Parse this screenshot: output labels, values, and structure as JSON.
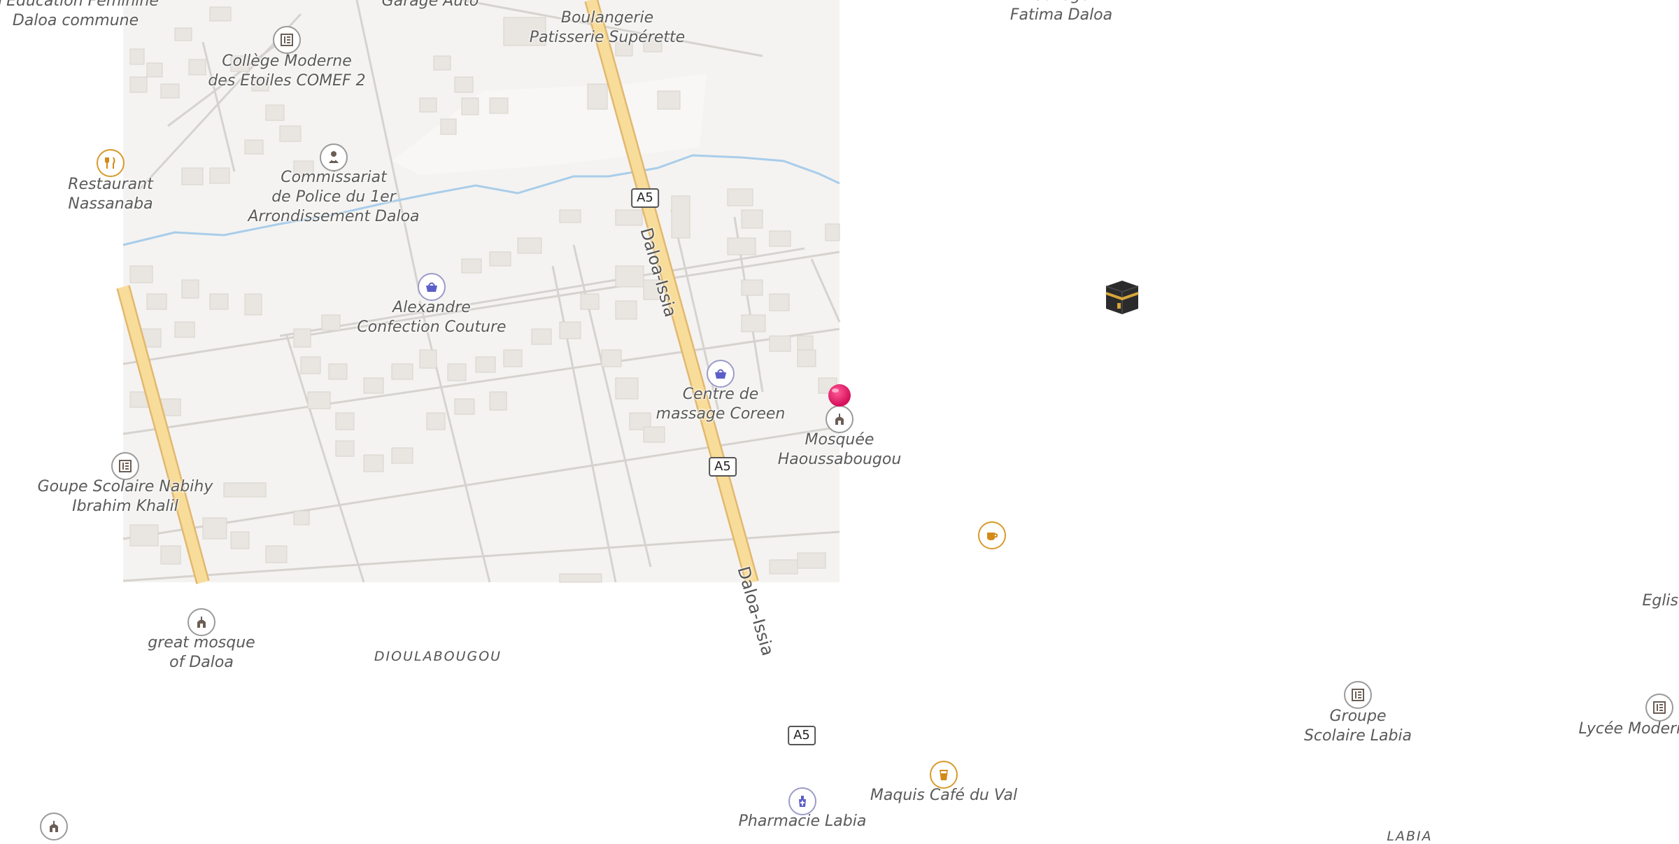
{
  "map": {
    "places": {
      "edu_feminine": "d'Education Féminine\nDaloa commune",
      "garage": "Garage Auto",
      "boulangerie": "Boulangerie\nPatisserie Supérette",
      "college_fatima": "College\nFatima Daloa",
      "college_comef": "Collège Moderne\ndes Etoiles COMEF 2",
      "restaurant": "Restaurant\nNassanaba",
      "commissariat": "Commissariat\nde Police du 1er\nArrondissement Daloa",
      "alexandre": "Alexandre\nConfection Couture",
      "massage": "Centre de\nmassage Coreen",
      "mosquee": "Mosquée\nHaoussabougou",
      "goupe_scolaire": "Goupe Scolaire Nabihy\nIbrahim Khalil",
      "great_mosque": "great mosque\nof Daloa",
      "dioulabougou": "DIOULABOUGOU",
      "eglise": "Eglise",
      "groupe_labia": "Groupe\nScolaire Labia",
      "lycee": "Lycée Moderne",
      "maquis": "Maquis Café du Val",
      "pharmacie": "Pharmacie Labia",
      "labia": "LABIA"
    },
    "roads": {
      "shield_a5": "A5",
      "daloa_issia": "Daloa-Issia"
    },
    "icons": {
      "school": "school-icon",
      "restaurant": "restaurant-icon",
      "police": "police-icon",
      "shop": "shopping-basket-icon",
      "mosque": "mosque-icon",
      "cafe": "cafe-icon",
      "bar": "bar-icon",
      "pharmacy": "pharmacy-icon",
      "pin": "location-pin-icon",
      "kaaba": "kaaba-icon"
    },
    "colors": {
      "tile_bg": "#f4f3f1",
      "building": "#e9e5e0",
      "main_road": "#f8dc9a",
      "main_road_edge": "#e2b870",
      "river": "#a9cdea",
      "pin": "#e8196b"
    }
  }
}
